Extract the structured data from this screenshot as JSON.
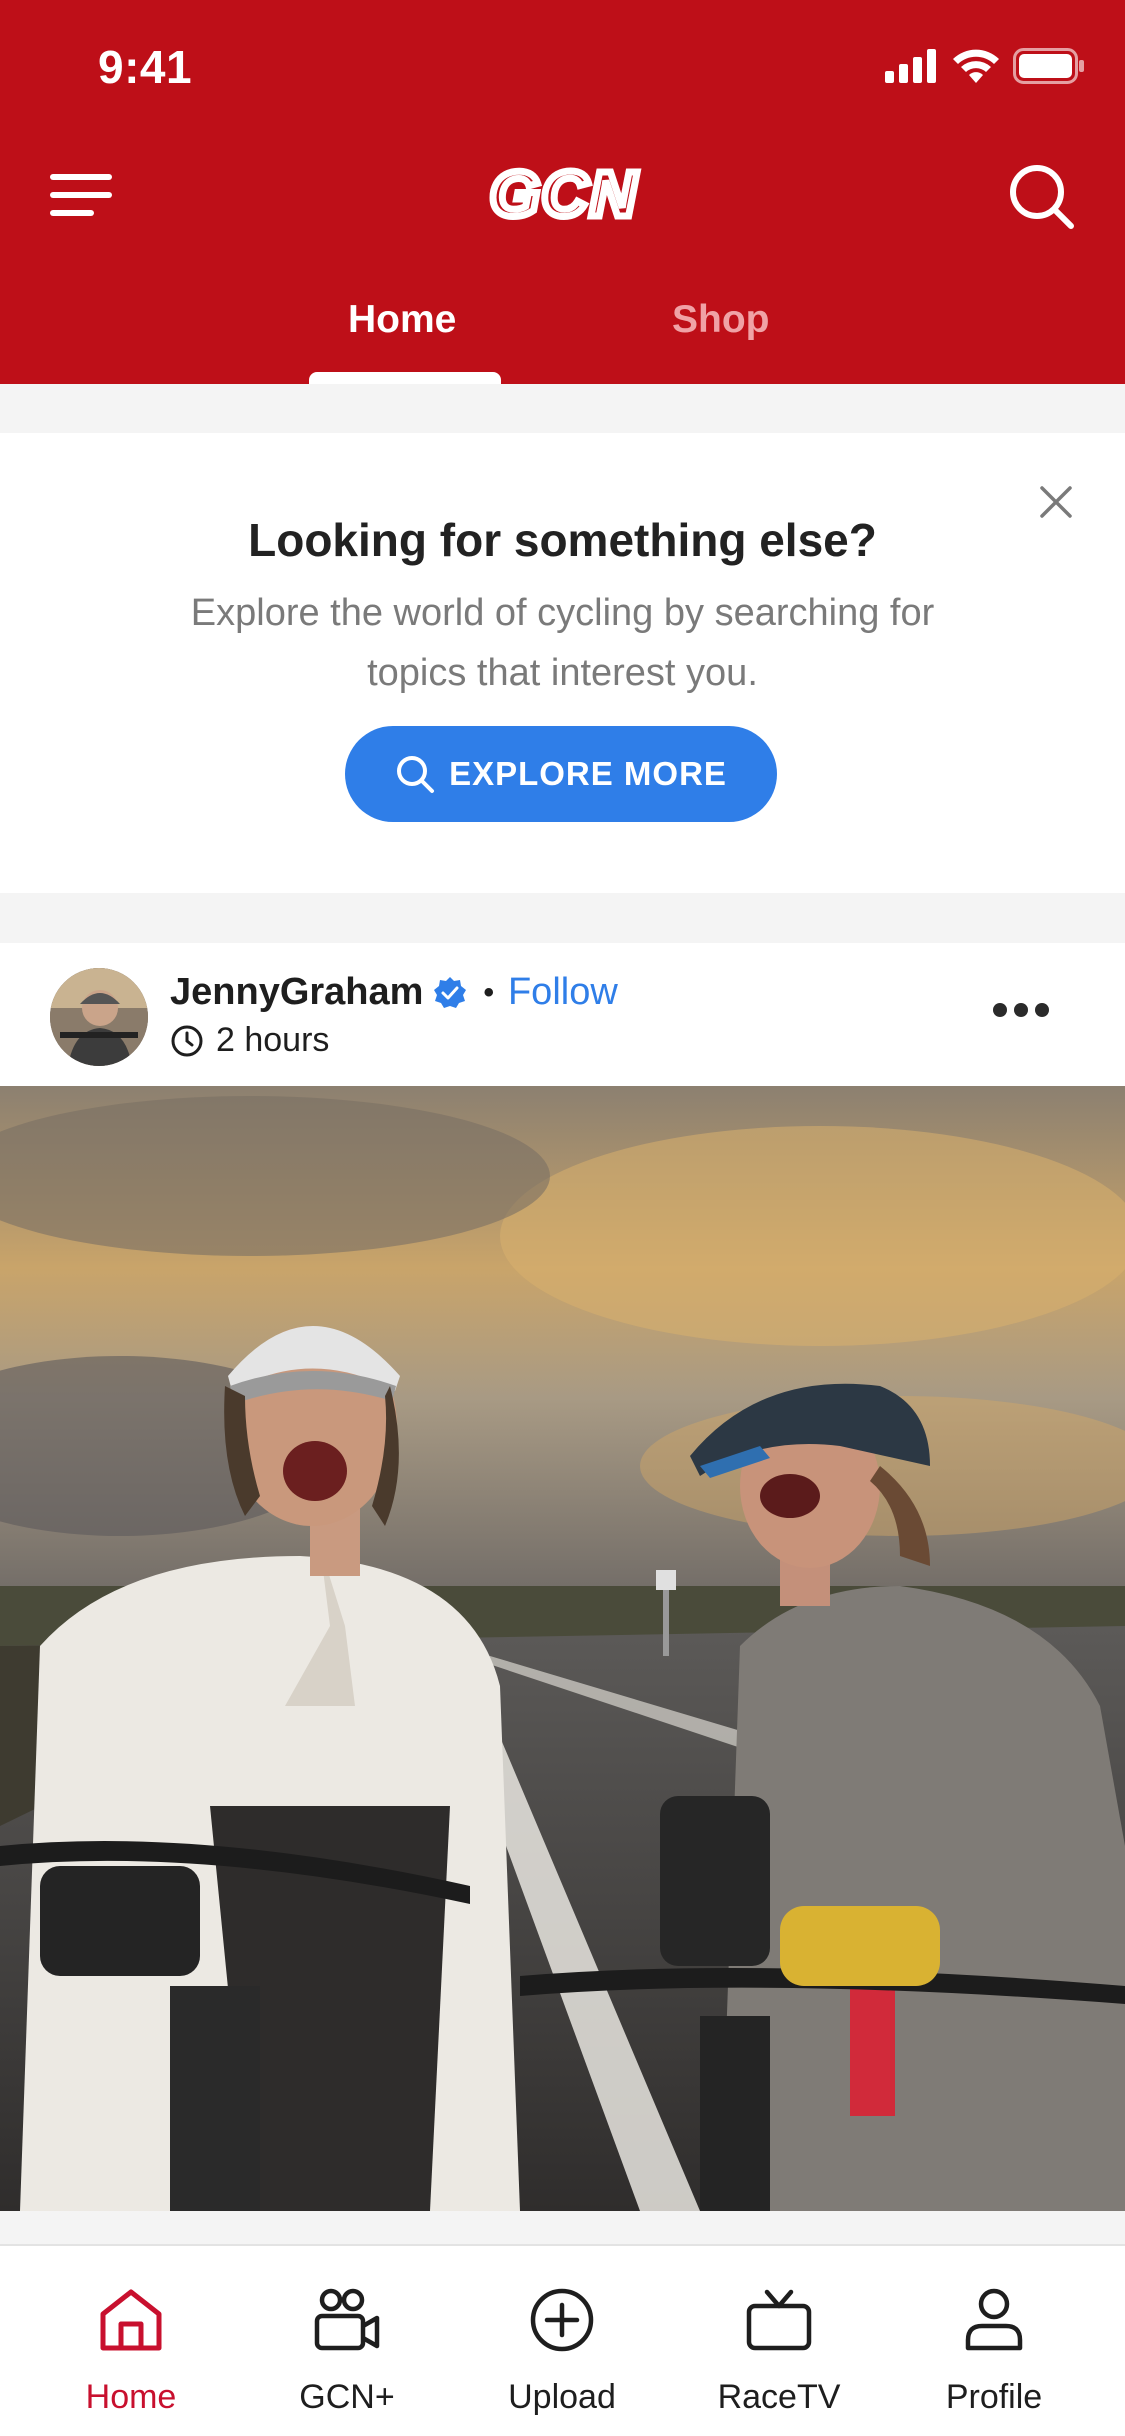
{
  "status_bar": {
    "time": "9:41"
  },
  "header": {
    "brand": "GCN",
    "tabs": [
      {
        "label": "Home",
        "active": true
      },
      {
        "label": "Shop",
        "active": false
      }
    ],
    "accent_color": "#be0f18"
  },
  "explore_card": {
    "title": "Looking for something else?",
    "description": "Explore the world of cycling by searching for topics that interest you.",
    "button_label": "EXPLORE MORE",
    "button_color": "#2f7ee8"
  },
  "post": {
    "author": "JennyGraham",
    "verified": true,
    "follow_label": "Follow",
    "time_ago": "2 hours",
    "image_icon": "two-cyclists-photo"
  },
  "bottom_nav": {
    "items": [
      {
        "label": "Home",
        "icon": "home-icon",
        "active": true
      },
      {
        "label": "GCN+",
        "icon": "people-camera-icon",
        "active": false
      },
      {
        "label": "Upload",
        "icon": "plus-circle-icon",
        "active": false
      },
      {
        "label": "RaceTV",
        "icon": "tv-icon",
        "active": false
      },
      {
        "label": "Profile",
        "icon": "person-icon",
        "active": false
      }
    ],
    "active_color": "#c8102e"
  }
}
